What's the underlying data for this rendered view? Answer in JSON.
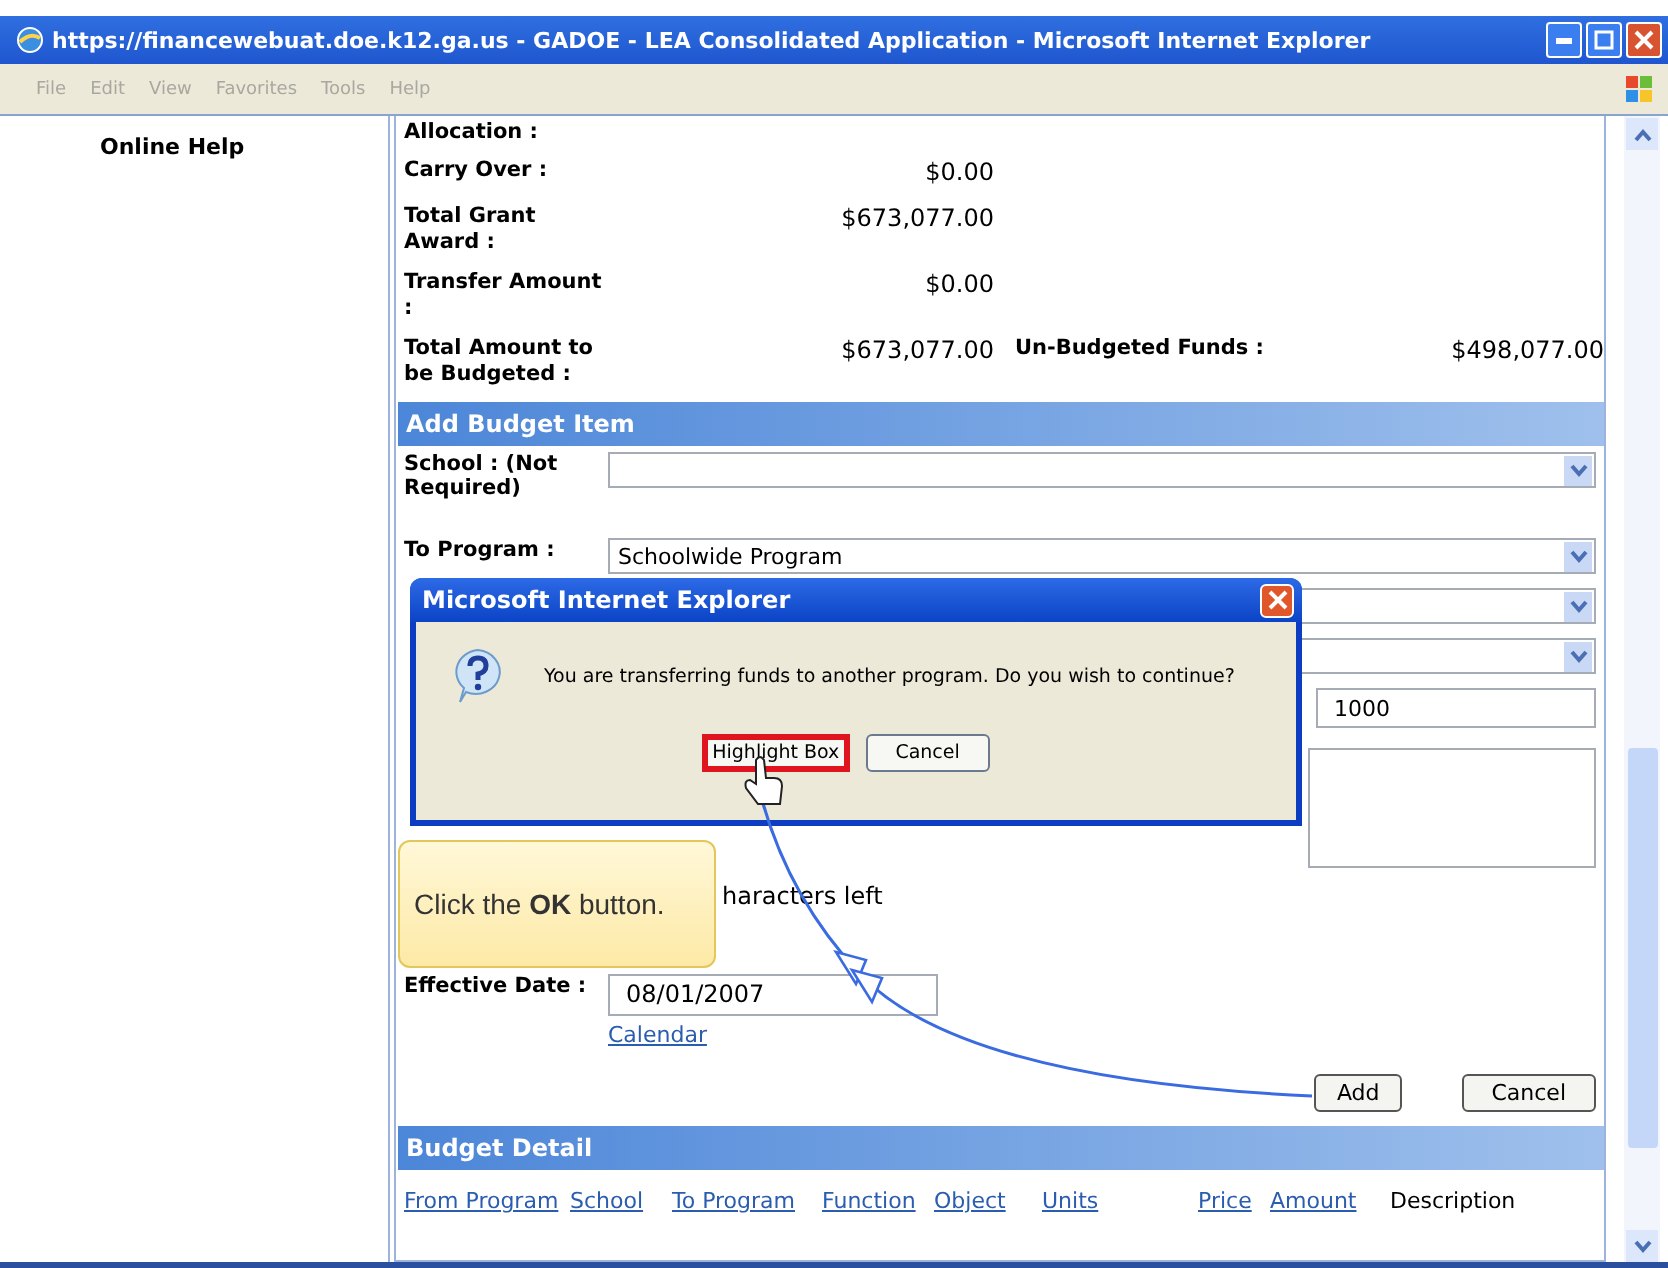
{
  "window": {
    "title": "https://financewebuat.doe.k12.ga.us - GADOE - LEA Consolidated Application - Microsoft Internet Explorer",
    "menu": [
      "File",
      "Edit",
      "View",
      "Favorites",
      "Tools",
      "Help"
    ]
  },
  "sidebar": {
    "items": [
      "Online Help"
    ]
  },
  "summary": [
    {
      "label": "Allocation :"
    },
    {
      "label": "Carry Over :",
      "value": "$0.00"
    },
    {
      "label": "Total Grant Award :",
      "value": "$673,077.00"
    },
    {
      "label": "Transfer Amount :",
      "value": "$0.00"
    },
    {
      "label": "Total Amount to be Budgeted :",
      "value": "$673,077.00",
      "extra_label": "Un-Budgeted Funds :",
      "extra_value": "$498,077.00"
    }
  ],
  "add_budget_item": {
    "title": "Add Budget Item",
    "fields": [
      {
        "kind": "select",
        "label": "School : (Not Required)"
      },
      {
        "kind": "select",
        "label": "To Program :",
        "value": "Schoolwide Program"
      },
      {
        "kind": "select"
      },
      {
        "kind": "select"
      },
      {
        "kind": "input",
        "value": "1000"
      },
      {
        "kind": "textarea"
      }
    ],
    "chars_left": "haracters left",
    "effective_date": {
      "label": "Effective Date :",
      "value": "08/01/2007",
      "link": "Calendar"
    },
    "buttons": [
      "Add",
      "Cancel"
    ]
  },
  "budget_detail": {
    "title": "Budget Detail",
    "columns": [
      {
        "label": "From Program",
        "link": true
      },
      {
        "label": "School",
        "link": true
      },
      {
        "label": "To Program",
        "link": true
      },
      {
        "label": "Function",
        "link": true
      },
      {
        "label": "Object",
        "link": true
      },
      {
        "label": "Units",
        "link": true
      },
      {
        "label": "Price",
        "link": true
      },
      {
        "label": "Amount",
        "link": true
      },
      {
        "label": "Description",
        "link": false
      }
    ]
  },
  "dialog": {
    "title": "Microsoft Internet Explorer",
    "message": "You are transferring funds to another program.  Do you wish to continue?",
    "buttons": [
      {
        "label": "Highlight Box",
        "highlighted": true
      },
      {
        "label": "Cancel",
        "highlighted": false
      }
    ]
  },
  "callout": {
    "text": "Click the **OK** button."
  }
}
